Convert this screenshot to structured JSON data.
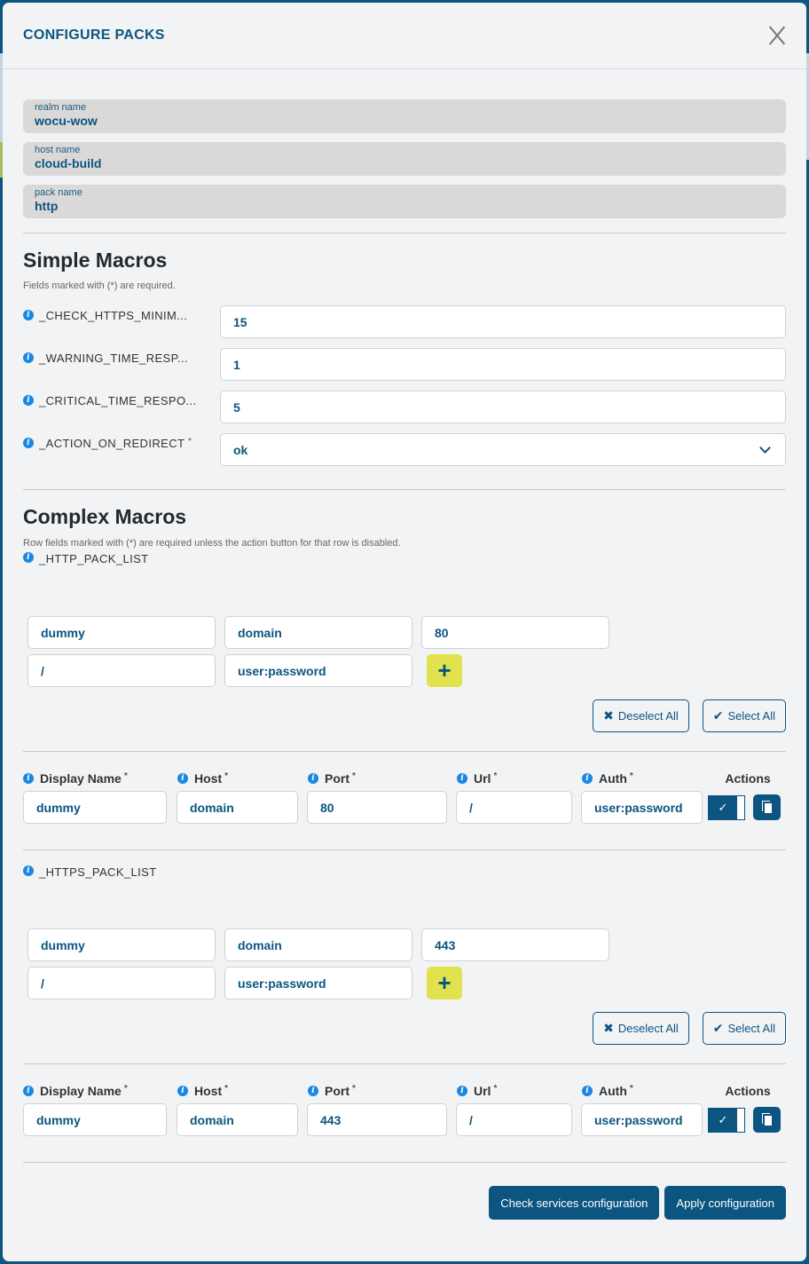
{
  "modal": {
    "title": "CONFIGURE PACKS",
    "close_icon": "close-icon"
  },
  "info_fields": [
    {
      "label": "realm name",
      "value": "wocu-wow"
    },
    {
      "label": "host name",
      "value": "cloud-build"
    },
    {
      "label": "pack name",
      "value": "http"
    }
  ],
  "simple_macros": {
    "title": "Simple Macros",
    "note": "Fields marked with (*) are required.",
    "rows": [
      {
        "label": "_CHECK_HTTPS_MINIM...",
        "required": "",
        "value": "15",
        "type": "text"
      },
      {
        "label": "_WARNING_TIME_RESP...",
        "required": "",
        "value": "1",
        "type": "text"
      },
      {
        "label": "_CRITICAL_TIME_RESPO...",
        "required": "",
        "value": "5",
        "type": "text"
      },
      {
        "label": "_ACTION_ON_REDIRECT",
        "required": "*",
        "value": "ok",
        "type": "select"
      }
    ]
  },
  "complex_macros": {
    "title": "Complex Macros",
    "note": "Row fields marked with (*) are required unless the action button for that row is disabled.",
    "deselect_all": "Deselect All",
    "select_all": "Select All",
    "add_label": "+",
    "columns": [
      "Display Name",
      "Host",
      "Port",
      "Url",
      "Auth"
    ],
    "required_mark": "*",
    "actions_header": "Actions",
    "lists": [
      {
        "name": "_HTTP_PACK_LIST",
        "new_row": {
          "display_name": "dummy",
          "host": "domain",
          "port": "80",
          "url": "/",
          "auth": "user:password"
        },
        "rows": [
          {
            "display_name": "dummy",
            "host": "domain",
            "port": "80",
            "url": "/",
            "auth": "user:password",
            "enabled": true
          }
        ]
      },
      {
        "name": "_HTTPS_PACK_LIST",
        "new_row": {
          "display_name": "dummy",
          "host": "domain",
          "port": "443",
          "url": "/",
          "auth": "user:password"
        },
        "rows": [
          {
            "display_name": "dummy",
            "host": "domain",
            "port": "443",
            "url": "/",
            "auth": "user:password",
            "enabled": true
          }
        ]
      }
    ]
  },
  "footer": {
    "check_button": "Check services configuration",
    "apply_button": "Apply configuration"
  },
  "colors": {
    "primary": "#0c5580",
    "accent_add": "#e1e24d",
    "info": "#1a87e4",
    "background": "#f2f3f5"
  }
}
